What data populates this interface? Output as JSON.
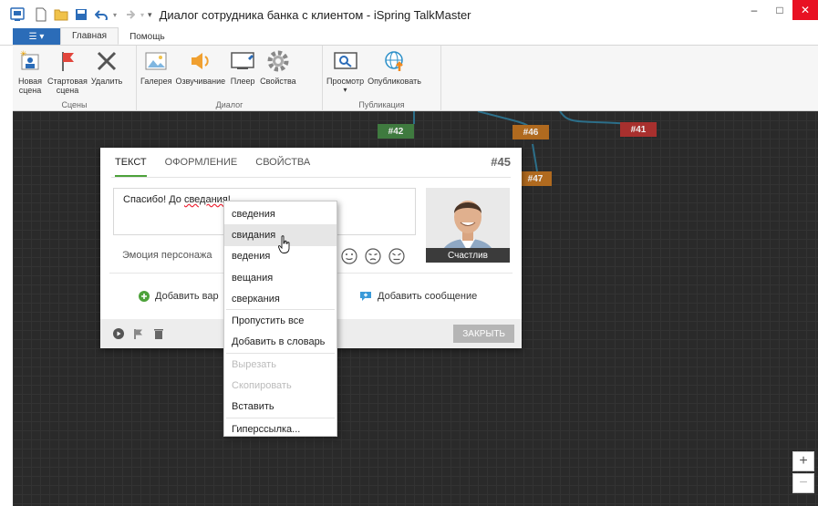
{
  "window": {
    "title": "Диалог сотрудника банка с клиентом - iSpring TalkMaster",
    "minimize": "–",
    "maximize": "□",
    "close": "✕"
  },
  "ribbon": {
    "file_tab": "☰ ▾",
    "tabs": [
      "Главная",
      "Помощь"
    ],
    "groups": {
      "scenes": {
        "label": "Сцены",
        "buttons": [
          "Новая\nсцена",
          "Стартовая\nсцена",
          "Удалить"
        ]
      },
      "dialog": {
        "label": "Диалог",
        "buttons": [
          "Галерея",
          "Озвучивание",
          "Плеер",
          "Свойства"
        ]
      },
      "publish": {
        "label": "Публикация",
        "buttons": [
          "Просмотр",
          "Опубликовать"
        ]
      }
    }
  },
  "canvas": {
    "nodes": [
      {
        "label": "#42",
        "color": "#3f7a3f"
      },
      {
        "label": "#46",
        "color": "#b06a1f"
      },
      {
        "label": "#41",
        "color": "#a8302e"
      },
      {
        "label": "#47",
        "color": "#b06a1f"
      }
    ],
    "zoom_in": "+",
    "zoom_out": "−"
  },
  "panel": {
    "tabs": [
      "Текст",
      "Оформление",
      "Свойства"
    ],
    "id": "#45",
    "text_before": "Спасибо! До ",
    "text_misspelled": "сведания",
    "text_after": "!",
    "emotion_label": "Эмоция персонажа",
    "avatar_caption": "Счастлив",
    "add_variant": "Добавить вар",
    "add_message": "Добавить сообщение",
    "close_button": "ЗАКРЫТЬ"
  },
  "context_menu": {
    "suggestions": [
      "сведения",
      "свидания",
      "ведения",
      "вещания",
      "сверкания"
    ],
    "actions": [
      "Пропустить все",
      "Добавить в словарь"
    ],
    "edit": [
      "Вырезать",
      "Скопировать",
      "Вставить"
    ],
    "link": [
      "Гиперссылка..."
    ]
  },
  "colors": {
    "accent": "#2b6cb8",
    "active_tab_underline": "#4da23a",
    "canvas_bg": "#2a2a2a"
  }
}
